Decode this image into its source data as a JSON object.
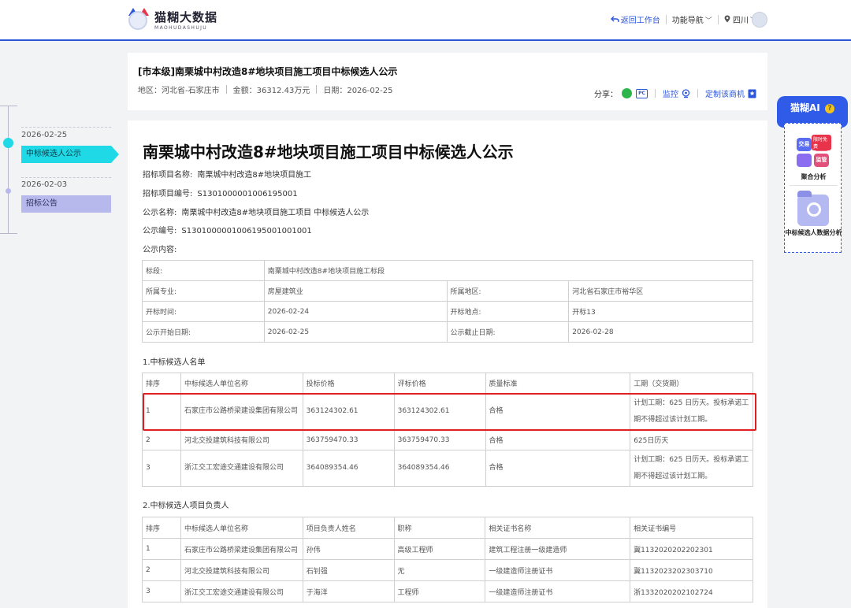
{
  "header": {
    "logo_cn": "猫糊大数据",
    "logo_en": "MAOHUDASHUJU",
    "back_label": "返回工作台",
    "nav_label": "功能导航",
    "region_label": "四川"
  },
  "title_card": {
    "title": "[市本级]南栗城中村改造8#地块项目施工项目中标候选人公示",
    "region": "地区：河北省-石家庄市",
    "amount": "金额：36312.43万元",
    "date": "日期：2026-02-25",
    "share_label": "分享：",
    "pc_label": "PC",
    "monitor_label": "监控",
    "custom_label": "定制该商机"
  },
  "timeline": {
    "items": [
      {
        "date": "2026-02-25",
        "label": "中标候选人公示"
      },
      {
        "date": "2026-02-03",
        "label": "招标公告"
      }
    ]
  },
  "main": {
    "title": "南栗城中村改造8#地块项目施工项目中标候选人公示",
    "fields": [
      {
        "k": "招标项目名称:",
        "v": "南栗城中村改造8#地块项目施工"
      },
      {
        "k": "招标项目编号:",
        "v": "S1301000001006195001"
      },
      {
        "k": "公示名称:",
        "v": "南栗城中村改造8#地块项目施工项目 中标候选人公示"
      },
      {
        "k": "公示编号:",
        "v": "S1301000001006195001001001"
      },
      {
        "k": "公示内容:",
        "v": ""
      }
    ],
    "info_table": {
      "bid_section_label": "标段:",
      "bid_section_value": "南栗城中村改造8#地块项目施工标段",
      "rows": [
        [
          "所属专业:",
          "房屋建筑业",
          "所属地区:",
          "河北省石家庄市裕华区"
        ],
        [
          "开标时间:",
          "2026-02-24",
          "开标地点:",
          "开标13"
        ],
        [
          "公示开始日期:",
          "2026-02-25",
          "公示截止日期:",
          "2026-02-28"
        ]
      ]
    },
    "section1": "1.中标候选人名单",
    "candidates": {
      "headers": [
        "排序",
        "中标候选人单位名称",
        "投标价格",
        "评标价格",
        "质量标准",
        "工期（交货期）"
      ],
      "rows": [
        [
          "1",
          "石家庄市公路桥梁建设集团有限公司",
          "363124302.61",
          "363124302.61",
          "合格",
          "计划工期：625 日历天。投标承诺工期不得超过该计划工期。"
        ],
        [
          "2",
          "河北交投建筑科技有限公司",
          "363759470.33",
          "363759470.33",
          "合格",
          "625日历天"
        ],
        [
          "3",
          "浙江交工宏途交通建设有限公司",
          "364089354.46",
          "364089354.46",
          "合格",
          "计划工期：625 日历天。投标承诺工期不得超过该计划工期。"
        ]
      ]
    },
    "section2": "2.中标候选人项目负责人",
    "managers": {
      "headers": [
        "排序",
        "中标候选人单位名称",
        "项目负责人姓名",
        "职称",
        "相关证书名称",
        "相关证书编号"
      ],
      "rows": [
        [
          "1",
          "石家庄市公路桥梁建设集团有限公司",
          "孙伟",
          "高级工程师",
          "建筑工程注册一级建造师",
          "冀1132020202202301"
        ],
        [
          "2",
          "河北交投建筑科技有限公司",
          "石钊强",
          "无",
          "一级建造师注册证书",
          "冀1132023202303710"
        ],
        [
          "3",
          "浙江交工宏途交通建设有限公司",
          "于海洋",
          "工程师",
          "一级建造师注册证书",
          "浙1332020202102724"
        ]
      ]
    }
  },
  "ai_widget": {
    "title": "猫糊AI",
    "help": "?",
    "tile1": "交易",
    "tile2": "监管",
    "badge": "限时免费",
    "item1_label": "聚合分析",
    "item2_label": "中标候选人数据分析"
  },
  "colors": {
    "brand_blue": "#2a55d8",
    "timeline_active": "#20d9e6",
    "timeline_inactive": "#b7b9ec",
    "highlight_red": "#e02020"
  }
}
